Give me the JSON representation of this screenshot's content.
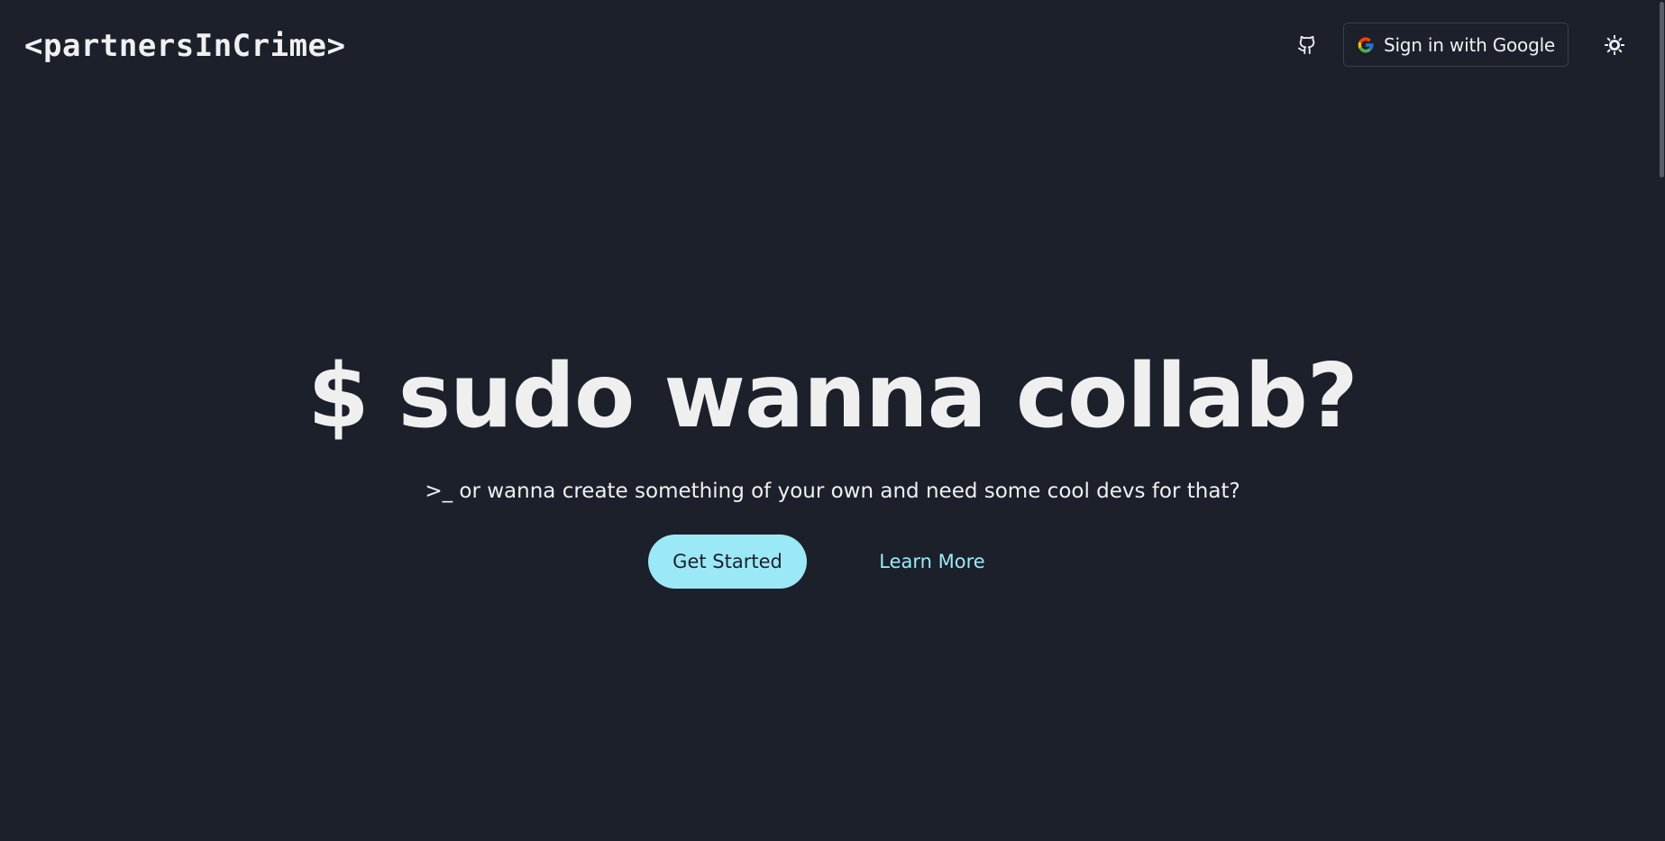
{
  "header": {
    "logo_text": "<partnersInCrime>",
    "github_icon": "github-icon",
    "google_signin_label": "Sign in with Google",
    "google_icon": "google-g-icon",
    "theme_icon": "sun-icon"
  },
  "hero": {
    "title": "$ sudo wanna collab?",
    "subtitle": ">_ or wanna create something of your own and need some cool devs for that?",
    "primary_cta": "Get Started",
    "secondary_cta": "Learn More"
  },
  "colors": {
    "background": "#1c202b",
    "text": "#efefef",
    "accent": "#9be9f7",
    "border": "#3a3f4b"
  }
}
